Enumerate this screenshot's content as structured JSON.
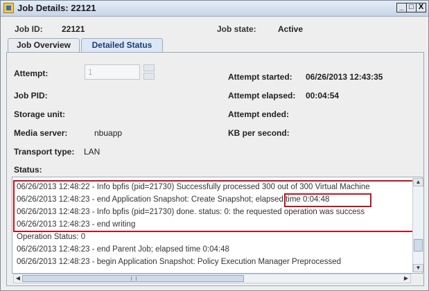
{
  "window": {
    "title": "Job Details: 22121",
    "min_label": "_",
    "max_label": "□",
    "close_label": "X"
  },
  "jobinfo": {
    "id_label": "Job ID:",
    "id_value": "22121",
    "state_label": "Job state:",
    "state_value": "Active"
  },
  "tabs": [
    {
      "label": "Job Overview"
    },
    {
      "label": "Detailed Status"
    }
  ],
  "details": {
    "attempt_label": "Attempt:",
    "attempt_value": "1",
    "job_pid_label": "Job PID:",
    "storage_unit_label": "Storage unit:",
    "media_server_label": "Media server:",
    "media_server_value": "nbuapp",
    "transport_type_label": "Transport type:",
    "transport_type_value": "LAN",
    "attempt_started_label": "Attempt started:",
    "attempt_started_value": "06/26/2013 12:43:35",
    "attempt_elapsed_label": "Attempt elapsed:",
    "attempt_elapsed_value": "00:04:54",
    "attempt_ended_label": "Attempt ended:",
    "kb_per_second_label": "KB per second:",
    "status_label": "Status:"
  },
  "status_log": [
    "06/26/2013 12:48:22 - Info bpfis (pid=21730) Successfully processed 300 out of 300 Virtual Machine",
    "06/26/2013 12:48:23 - end Application Snapshot: Create Snapshot; elapsed time 0:04:48",
    "06/26/2013 12:48:23 - Info bpfis (pid=21730) done. status: 0: the requested operation was success",
    "06/26/2013 12:48:23 - end writing",
    "Operation Status: 0",
    "06/26/2013 12:48:23 - end Parent Job; elapsed time 0:04:48",
    "06/26/2013 12:48:23 - begin Application Snapshot: Policy Execution Manager Preprocessed"
  ],
  "highlight_text": "elapsed time 0:04:48",
  "colors": {
    "highlight": "#c0141e",
    "accent": "#1a3e70"
  }
}
